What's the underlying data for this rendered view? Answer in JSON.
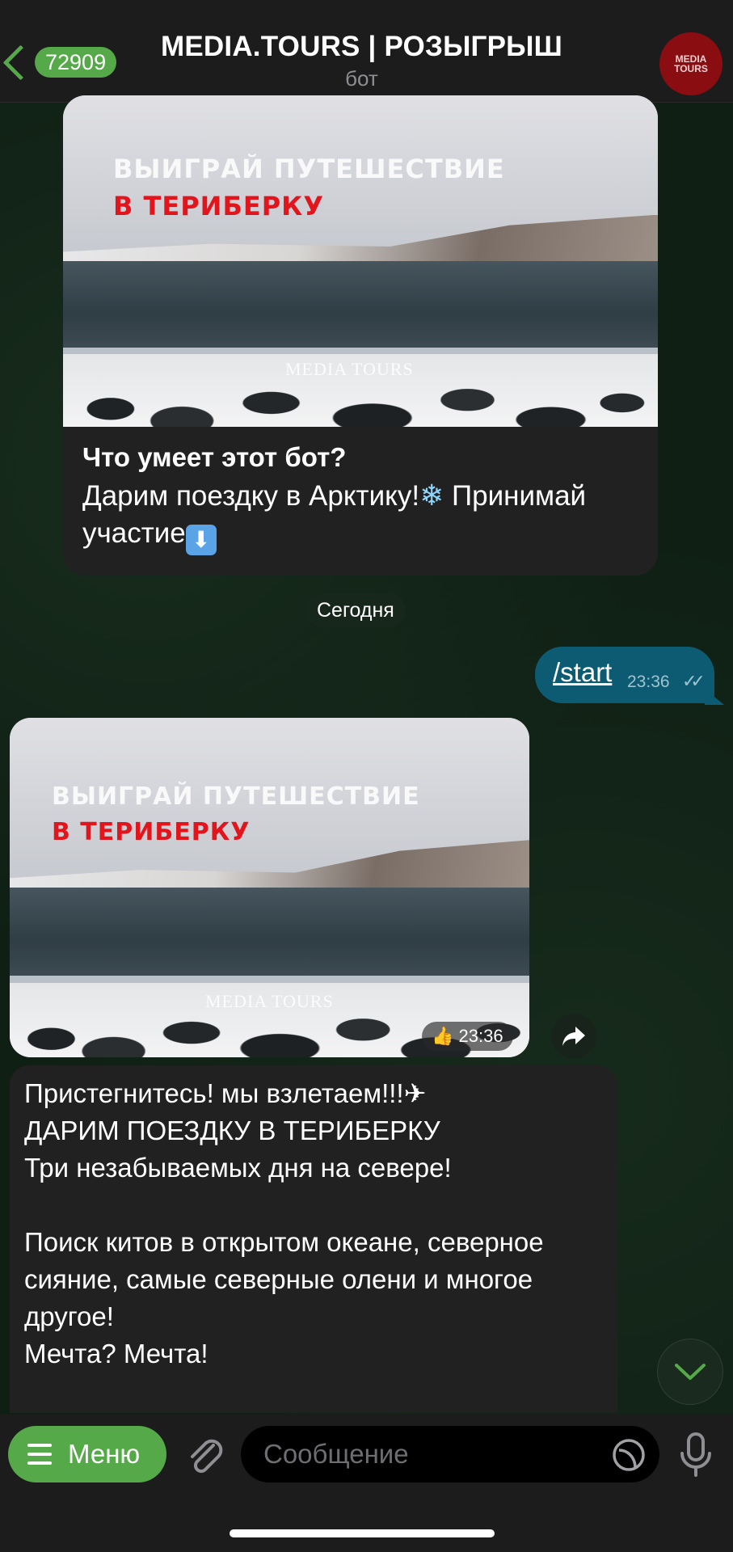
{
  "header": {
    "back_count": "72909",
    "title": "MEDIA.TOURS | РОЗЫГРЫШ",
    "subtitle": "бот",
    "avatar_text": "MEDIA TOURS"
  },
  "intro": {
    "image_headline_1": "ВЫИГРАЙ ПУТЕШЕСТВИЕ",
    "image_headline_2": "В ТЕРИБЕРКУ",
    "image_watermark": "MEDIA TOURS",
    "title": "Что умеет этот бот?",
    "body": "Дарим поездку в Арктику!",
    "body_emoji_1": "❄",
    "body_tail": " Принимай",
    "body_line2": "участие",
    "body_emoji_2": "⬇"
  },
  "date_separator": "Сегодня",
  "outgoing": {
    "text": "/start",
    "time": "23:36",
    "status": "read"
  },
  "incoming_photo": {
    "headline_1": "ВЫИГРАЙ ПУТЕШЕСТВИЕ",
    "headline_2": "В ТЕРИБЕРКУ",
    "watermark": "MEDIA TOURS",
    "reaction": "👍",
    "time": "23:36"
  },
  "incoming_text": {
    "lines": [
      "Пристегнитесь! мы взлетаем!!!✈",
      "ДАРИМ ПОЕЗДКУ В ТЕРИБЕРКУ",
      "Три незабываемых дня на севере!",
      "",
      "Поиск китов в открытом океане, северное",
      "сияние, самые северные олени и многое",
      "другое!",
      "Мечта? Мечта!"
    ]
  },
  "bottom": {
    "menu_label": "Меню",
    "input_placeholder": "Сообщение"
  },
  "colors": {
    "accent_green": "#55a948",
    "outgoing_bubble": "#0d5b73",
    "incoming_bubble": "#212121",
    "headline_red": "#e3151c"
  },
  "icons": [
    "chevron-left-icon",
    "paperclip-icon",
    "sticker-icon",
    "microphone-icon",
    "share-icon",
    "chevron-down-icon",
    "menu-icon",
    "double-check-icon"
  ]
}
